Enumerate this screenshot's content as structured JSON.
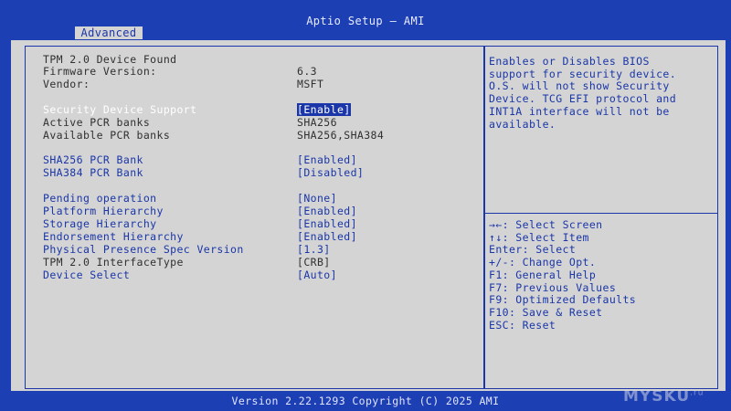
{
  "window": {
    "title": "Aptio Setup – AMI",
    "footer": "Version 2.22.1293 Copyright (C) 2025 AMI"
  },
  "tabs": [
    {
      "label": "Advanced",
      "active": true
    }
  ],
  "settings": [
    {
      "label": "TPM 2.0 Device Found",
      "value": "",
      "type": "info"
    },
    {
      "label": "Firmware Version:",
      "value": "6.3",
      "type": "info"
    },
    {
      "label": "Vendor:",
      "value": "MSFT",
      "type": "info"
    },
    {
      "label": "Security Device Support",
      "value": "[Enable]",
      "type": "selected"
    },
    {
      "label": "Active PCR banks",
      "value": "SHA256",
      "type": "info"
    },
    {
      "label": "Available PCR banks",
      "value": "SHA256,SHA384",
      "type": "info"
    },
    {
      "label": "SHA256 PCR Bank",
      "value": "[Enabled]",
      "type": "option"
    },
    {
      "label": "SHA384 PCR Bank",
      "value": "[Disabled]",
      "type": "option"
    },
    {
      "label": "Pending operation",
      "value": "[None]",
      "type": "option"
    },
    {
      "label": "Platform Hierarchy",
      "value": "[Enabled]",
      "type": "option"
    },
    {
      "label": "Storage Hierarchy",
      "value": "[Enabled]",
      "type": "option"
    },
    {
      "label": "Endorsement Hierarchy",
      "value": "[Enabled]",
      "type": "option"
    },
    {
      "label": "Physical Presence Spec Version",
      "value": "[1.3]",
      "type": "option"
    },
    {
      "label": "TPM 2.0 InterfaceType",
      "value": "[CRB]",
      "type": "info"
    },
    {
      "label": "Device Select",
      "value": "[Auto]",
      "type": "option"
    }
  ],
  "help": {
    "lines": [
      "Enables or Disables BIOS",
      "support for security device.",
      "O.S. will not show Security",
      "Device. TCG EFI protocol and",
      "INT1A interface will not be",
      "available."
    ]
  },
  "keys": [
    {
      "glyph": "→←",
      "text": ": Select Screen"
    },
    {
      "glyph": "↑↓",
      "text": ": Select Item"
    },
    {
      "glyph": "",
      "text": "Enter: Select"
    },
    {
      "glyph": "",
      "text": "+/-: Change Opt."
    },
    {
      "glyph": "",
      "text": "F1: General Help"
    },
    {
      "glyph": "",
      "text": "F7: Previous Values"
    },
    {
      "glyph": "",
      "text": "F9: Optimized Defaults"
    },
    {
      "glyph": "",
      "text": "F10: Save & Reset"
    },
    {
      "glyph": "",
      "text": "ESC: Reset"
    }
  ],
  "watermark": {
    "text": "MYSKU",
    "suffix": ".ru"
  },
  "colors": {
    "bios_blue": "#1d3fb4",
    "panel_gray": "#d4d4d4",
    "text_blue": "#1a36a8",
    "text_dark": "#303030"
  }
}
